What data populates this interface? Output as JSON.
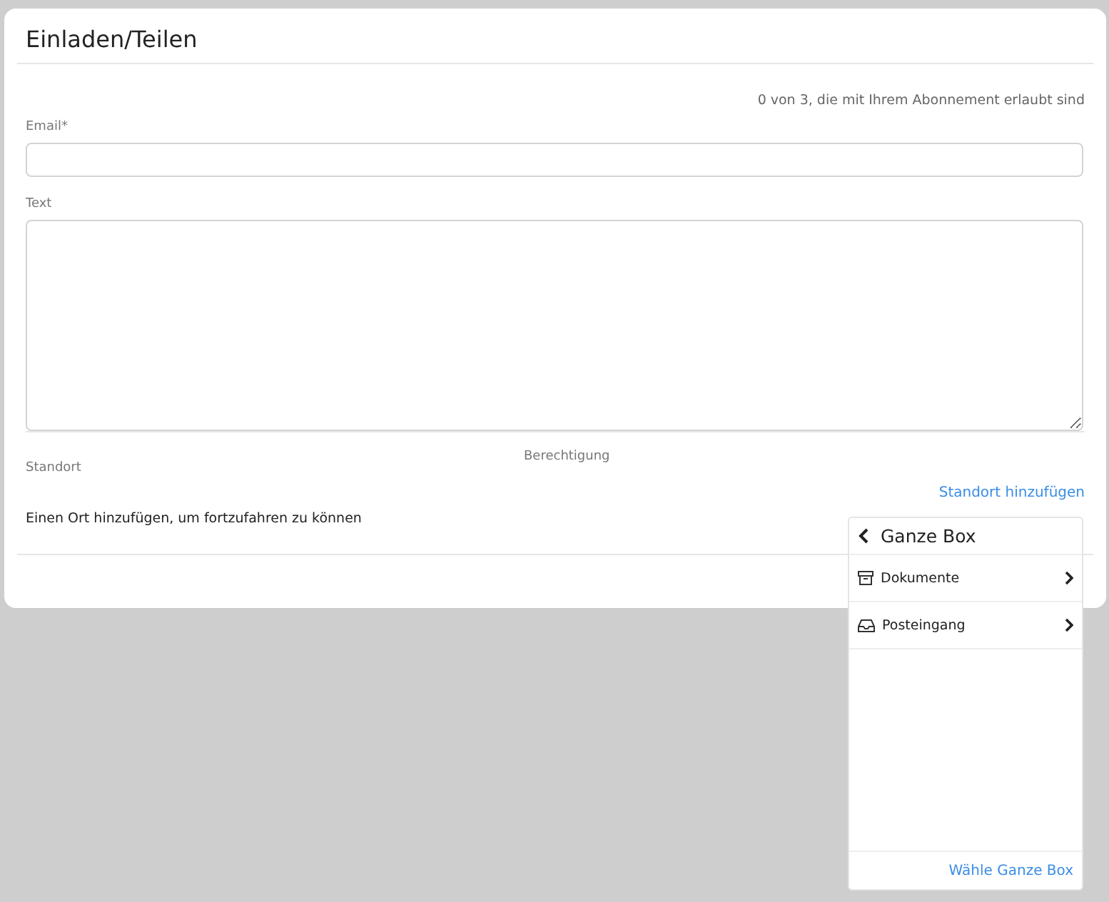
{
  "dialog": {
    "title": "Einladen/Teilen",
    "quota": "0 von 3, die mit Ihrem Abonnement erlaubt sind",
    "fields": [
      {
        "kind": "input",
        "label": "Email*"
      },
      {
        "kind": "textarea",
        "label": "Text"
      }
    ],
    "location_header": "Standort",
    "permission_header": "Berechtigung",
    "add_location_link": "Standort hinzufügen",
    "empty_message": "Einen Ort hinzufügen, um fortzufahren zu können"
  },
  "location_menu": {
    "title": "Ganze Box",
    "items": [
      {
        "kind": "archive",
        "label": "Dokumente"
      },
      {
        "kind": "inbox",
        "label": "Posteingang"
      }
    ],
    "footer_link": "Wähle Ganze Box"
  }
}
